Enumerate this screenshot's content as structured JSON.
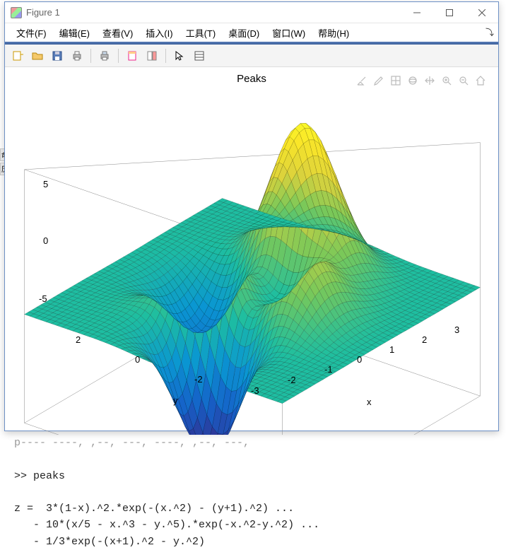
{
  "window": {
    "title": "Figure 1"
  },
  "menu": {
    "items": [
      "文件(F)",
      "编辑(E)",
      "查看(V)",
      "插入(I)",
      "工具(T)",
      "桌面(D)",
      "窗口(W)",
      "帮助(H)"
    ]
  },
  "toolbar": {
    "icons": [
      "new-figure",
      "open",
      "save",
      "print",
      "|",
      "print-preview",
      "|",
      "link-axes",
      "insert-colorbar",
      "|",
      "arrow-tool",
      "data-cursor"
    ]
  },
  "axes_tools": {
    "icons": [
      "brush",
      "edit-plot",
      "axes-props",
      "rotate3d",
      "pan",
      "zoom-in",
      "zoom-out",
      "home"
    ]
  },
  "plot": {
    "title": "Peaks",
    "xlabel": "x",
    "ylabel": "y",
    "zticks": [
      "-5",
      "0",
      "5"
    ],
    "yticks": [
      "-2",
      "0",
      "2"
    ],
    "xticks": [
      "-3",
      "-2",
      "-1",
      "0",
      "1",
      "2",
      "3"
    ]
  },
  "command": {
    "truncated": "p---- ----, ,--, ---, ----, ,--, ---,",
    "line1": ">> peaks",
    "eq0": "z =  3*(1-x).^2.*exp(-(x.^2) - (y+1).^2) ...",
    "eq1": "   - 10*(x/5 - x.^3 - y.^5).*exp(-x.^2-y.^2) ...",
    "eq2": "   - 1/3*exp(-(x+1).^2 - y.^2)"
  },
  "chart_data": {
    "type": "surface",
    "title": "Peaks",
    "xlabel": "x",
    "ylabel": "y",
    "zlabel": "",
    "xlim": [
      -3,
      3
    ],
    "ylim": [
      -3,
      3
    ],
    "zlim": [
      -6,
      8
    ],
    "xticks": [
      -3,
      -2,
      -1,
      0,
      1,
      2,
      3
    ],
    "yticks": [
      -2,
      0,
      2
    ],
    "zticks": [
      -5,
      0,
      5
    ],
    "formula": "z = 3*(1-x).^2.*exp(-(x.^2)-(y+1).^2) - 10*(x/5 - x.^3 - y.^5).*exp(-x.^2-y.^2) - 1/3*exp(-(x+1).^2 - y.^2)",
    "grid_resolution": 49,
    "view_azimuth": -37.5,
    "view_elevation": 30,
    "z_range_approx": {
      "min": -6.55,
      "max": 8.08
    },
    "colormap": "parula"
  }
}
